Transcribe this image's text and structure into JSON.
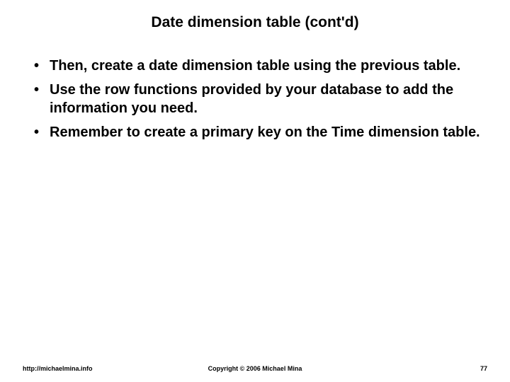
{
  "title": "Date dimension table (cont'd)",
  "bullets": [
    "Then, create a date dimension table using the previous table.",
    "Use the row functions provided by your database to add the information you need.",
    "Remember to create a primary key on the Time dimension table."
  ],
  "footer": {
    "left": "http://michaelmina.info",
    "center": "Copyright © 2006 Michael Mina",
    "right": "77"
  }
}
